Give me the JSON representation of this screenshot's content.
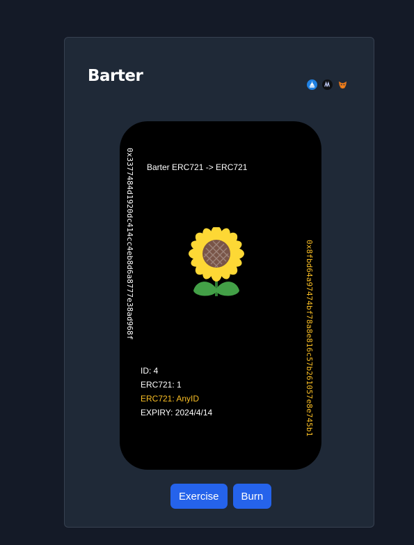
{
  "app": {
    "title": "Barter"
  },
  "header": {
    "wallet_icons": [
      "opensea-icon",
      "wallet-icon",
      "metamask-fox-icon"
    ]
  },
  "card": {
    "title": "Barter ERC721 -> ERC721",
    "left_address": "0x3377484d1920dc414cc4eb8d6a8777e38ad968f",
    "right_address": "0x8fbd64a97474bf78a8e816c57b261057e8e745b1",
    "image": "sunflower-icon",
    "details": {
      "id": "ID: 4",
      "erc721_offer": "ERC721: 1",
      "erc721_ask": "ERC721: AnyID",
      "expiry": "EXPIRY: 2024/4/14"
    }
  },
  "actions": {
    "exercise_label": "Exercise",
    "burn_label": "Burn"
  },
  "colors": {
    "background": "#141a27",
    "panel": "#1f2937",
    "card": "#000000",
    "accent": "#fbbf24",
    "button": "#2563eb"
  }
}
